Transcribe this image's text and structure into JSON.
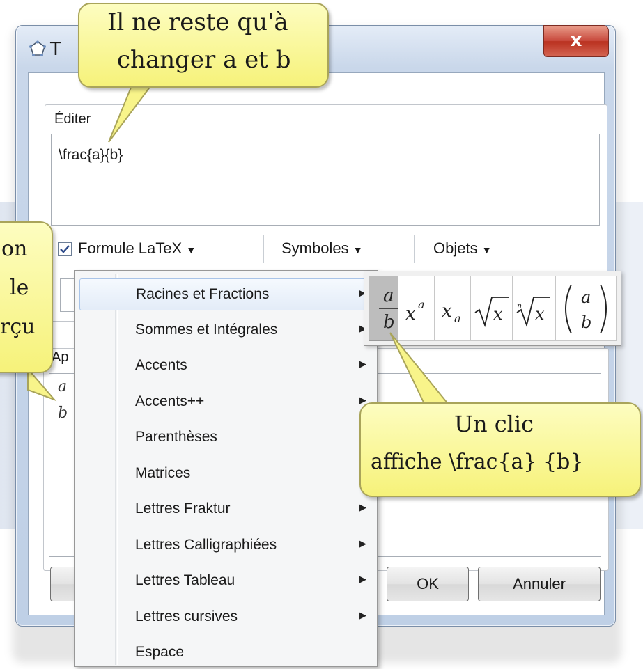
{
  "window": {
    "title_partial": "T",
    "close_label": "x"
  },
  "edit_group": {
    "label": "Éditer",
    "latex_content": "\\frac{a}{b}"
  },
  "toolbar": {
    "formula_label": "Formule LaTeX",
    "formula_checked": true,
    "symbols_label": "Symboles",
    "objects_label": "Objets"
  },
  "preview_group": {
    "label_partial": "Ap",
    "numerator": "a",
    "denominator": "b"
  },
  "buttons": {
    "ok": "OK",
    "cancel": "Annuler"
  },
  "menu": {
    "items": [
      {
        "label": "Racines et Fractions",
        "submenu": true,
        "highlighted": true
      },
      {
        "label": "Sommes et Intégrales",
        "submenu": true
      },
      {
        "label": "Accents",
        "submenu": true
      },
      {
        "label": "Accents++",
        "submenu": true
      },
      {
        "label": "Parenthèses",
        "submenu": false
      },
      {
        "label": "Matrices",
        "submenu": false
      },
      {
        "label": "Lettres Fraktur",
        "submenu": true
      },
      {
        "label": "Lettres Calligraphiées",
        "submenu": true
      },
      {
        "label": "Lettres Tableau",
        "submenu": true
      },
      {
        "label": "Lettres cursives",
        "submenu": true
      },
      {
        "label": "Espace",
        "submenu": false
      }
    ]
  },
  "submenu": {
    "symbols": [
      {
        "name": "fraction",
        "selected": true
      },
      {
        "name": "superscript"
      },
      {
        "name": "subscript"
      },
      {
        "name": "square-root"
      },
      {
        "name": "nth-root"
      },
      {
        "name": "binomial"
      }
    ]
  },
  "callouts": {
    "top": [
      "Il ne reste qu'à",
      "changer a et b"
    ],
    "left": [
      "on",
      "le",
      "rçu"
    ],
    "right": [
      "Un clic",
      "affiche \\frac{a} {b}"
    ]
  },
  "colors": {
    "bubble_fill": "#f8f48a",
    "bubble_border": "#a9a45a",
    "close_button": "#c7473a",
    "menu_highlight": "#e3ecf8"
  }
}
